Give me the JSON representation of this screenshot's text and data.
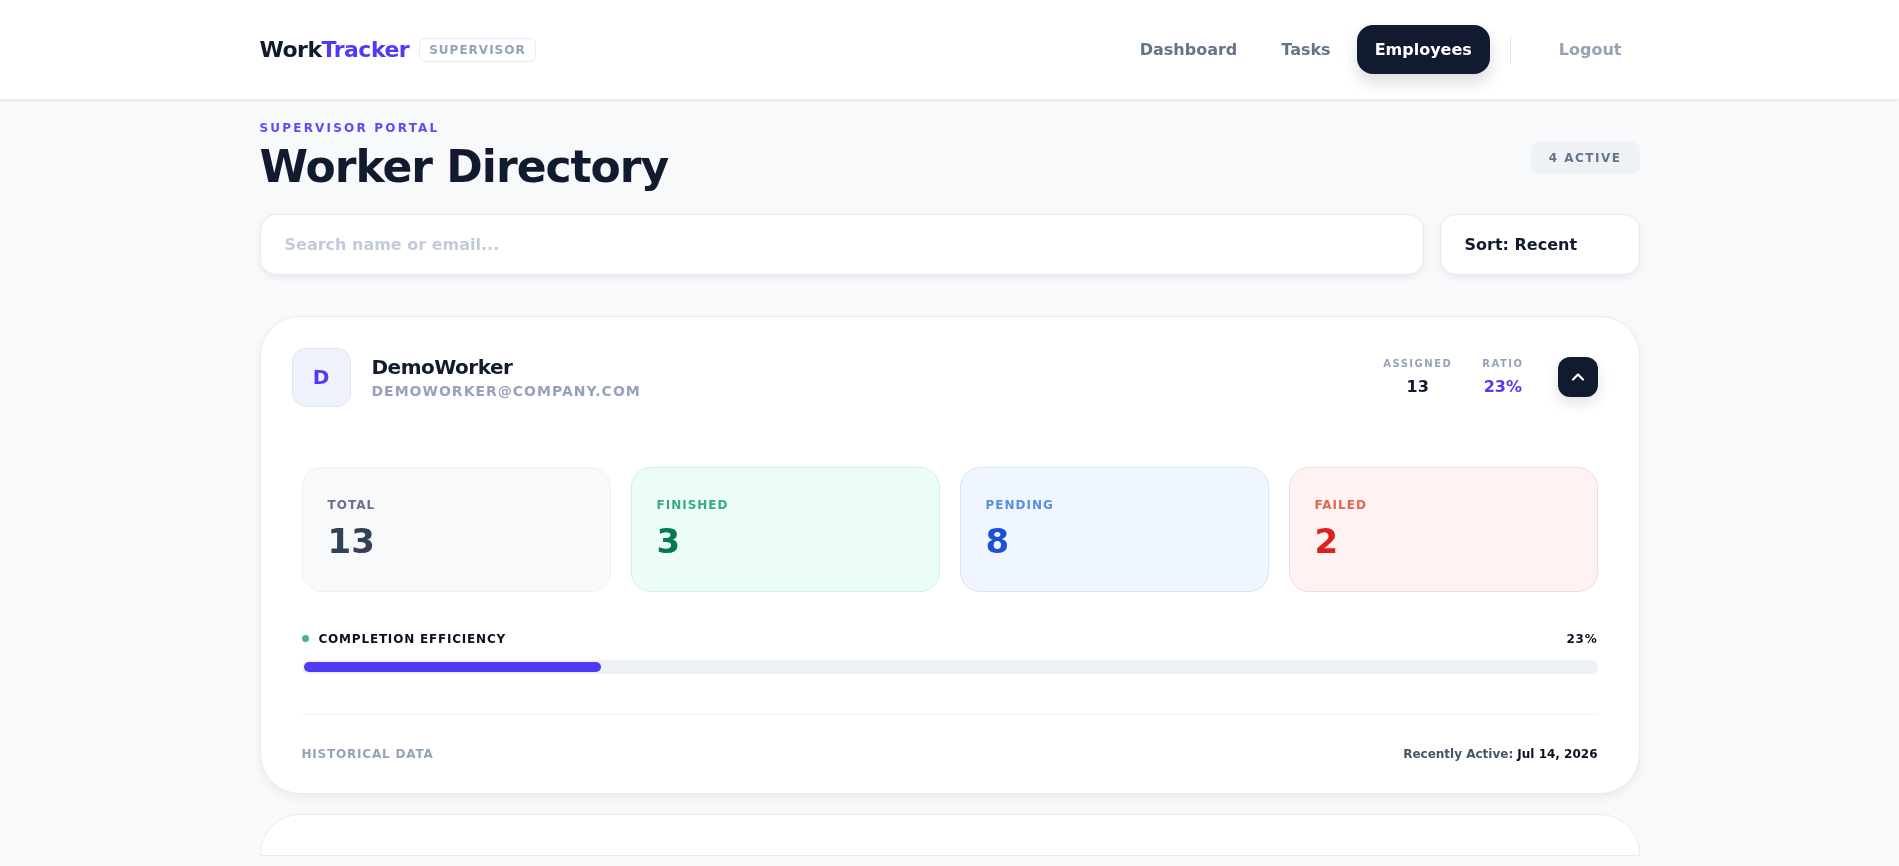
{
  "header": {
    "logo": {
      "primary": "Work",
      "accent": "Tracker"
    },
    "role_badge": "SUPERVISOR",
    "nav": [
      {
        "label": "Dashboard",
        "selected": false
      },
      {
        "label": "Tasks",
        "selected": false
      },
      {
        "label": "Employees",
        "selected": true
      }
    ],
    "logout": "Logout"
  },
  "page": {
    "eyebrow": "SUPERVISOR PORTAL",
    "title": "Worker Directory",
    "active_badge": "4 ACTIVE"
  },
  "filters": {
    "search": {
      "placeholder": "Search name or email..."
    },
    "sort": "Sort: Recent"
  },
  "workers": [
    {
      "initial": "D",
      "name": "DemoWorker",
      "email": "DEMOWORKER@COMPANY.COM",
      "assigned_label": "ASSIGNED",
      "assigned": "13",
      "ratio_label": "RATIO",
      "ratio": "23%",
      "expanded": true,
      "stats": [
        {
          "kind": "total",
          "label": "TOTAL",
          "value": "13"
        },
        {
          "kind": "finished",
          "label": "FINISHED",
          "value": "3"
        },
        {
          "kind": "pending",
          "label": "PENDING",
          "value": "8"
        },
        {
          "kind": "failed",
          "label": "FAILED",
          "value": "2"
        }
      ],
      "efficiency": {
        "label": "COMPLETION EFFICIENCY",
        "reading": "23%",
        "level": 0.23
      },
      "history_label": "HISTORICAL DATA",
      "last_active": "Recently Active: **Jul 14, 2026**"
    }
  ]
}
